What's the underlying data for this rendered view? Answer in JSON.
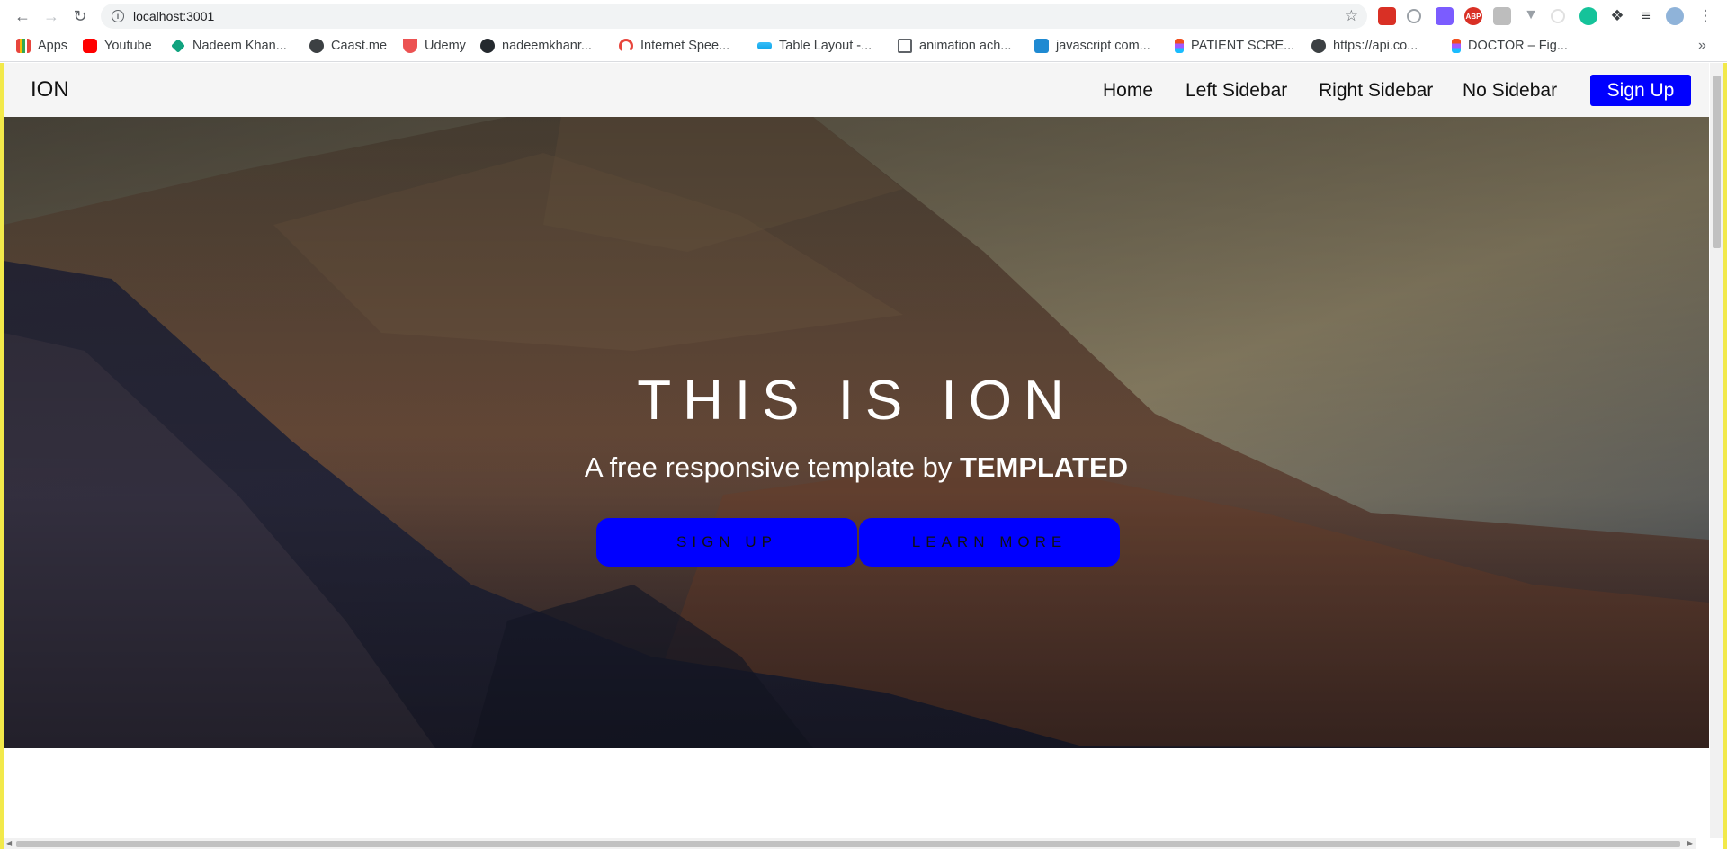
{
  "browser": {
    "url": "localhost:3001",
    "bookmarks": [
      {
        "label": "Apps",
        "icon": "apps-grid-icon",
        "color": "#e8453c"
      },
      {
        "label": "Youtube",
        "icon": "youtube-icon",
        "color": "#ff0000"
      },
      {
        "label": "Nadeem Khan...",
        "icon": "diamond-icon",
        "color": "#10a37f"
      },
      {
        "label": "Caast.me",
        "icon": "globe-icon",
        "color": "#3c4043"
      },
      {
        "label": "Udemy",
        "icon": "udemy-icon",
        "color": "#ec5252"
      },
      {
        "label": "nadeemkhanr...",
        "icon": "github-icon",
        "color": "#24292e"
      },
      {
        "label": "Internet Spee...",
        "icon": "speedometer-icon",
        "color": "#e8453c"
      },
      {
        "label": "Table Layout -...",
        "icon": "tailwind-icon",
        "color": "#38bdf8"
      },
      {
        "label": "animation ach...",
        "icon": "page-icon",
        "color": "#5f6368"
      },
      {
        "label": "javascript com...",
        "icon": "site-icon",
        "color": "#1f8ad2"
      },
      {
        "label": "PATIENT SCRE...",
        "icon": "figma-icon",
        "color": "#f24e1e"
      },
      {
        "label": "https://api.co...",
        "icon": "globe-icon",
        "color": "#3c4043"
      },
      {
        "label": "DOCTOR – Fig...",
        "icon": "figma-icon",
        "color": "#f24e1e"
      }
    ]
  },
  "site": {
    "logo": "ION",
    "nav": [
      "Home",
      "Left Sidebar",
      "Right Sidebar",
      "No Sidebar"
    ],
    "signup": "Sign Up",
    "accent": "#0000ff"
  },
  "hero": {
    "title": "THIS IS ION",
    "subtitle_prefix": "A free responsive template by ",
    "subtitle_brand": "TEMPLATED",
    "buttons": [
      "Sign Up",
      "Learn More"
    ]
  }
}
